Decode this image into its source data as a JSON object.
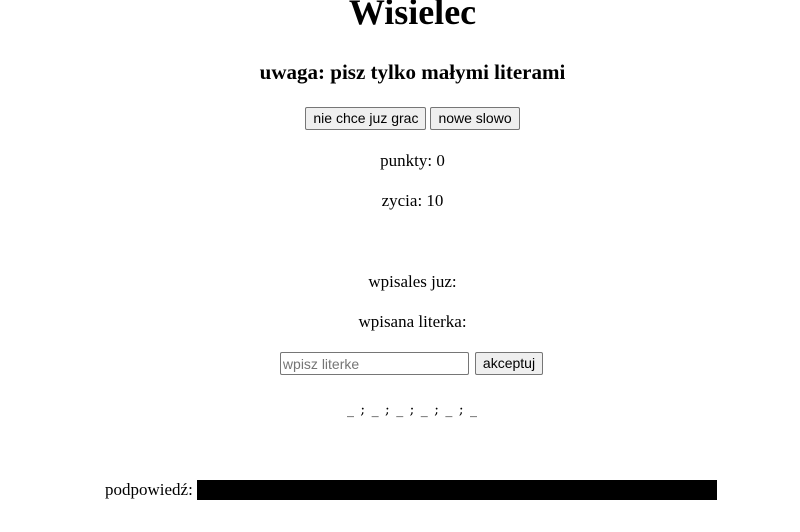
{
  "header": {
    "title": "Wisielec",
    "subtitle": "uwaga: pisz tylko małymi literami"
  },
  "actions": {
    "quit_label": "nie chce juz grac",
    "new_word_label": "nowe slowo"
  },
  "stats": {
    "points_text": "punkty: 0",
    "lives_text": "zycia: 10"
  },
  "guesses": {
    "typed_label": "wpisales juz:",
    "entered_letter_label": "wpisana literka:"
  },
  "input": {
    "placeholder": "wpisz literke",
    "value": "",
    "accept_label": "akceptuj"
  },
  "word": {
    "masked": "_ ; _ ; _ ; _ ; _ ; _"
  },
  "hint": {
    "label": "podpowiedź:"
  }
}
